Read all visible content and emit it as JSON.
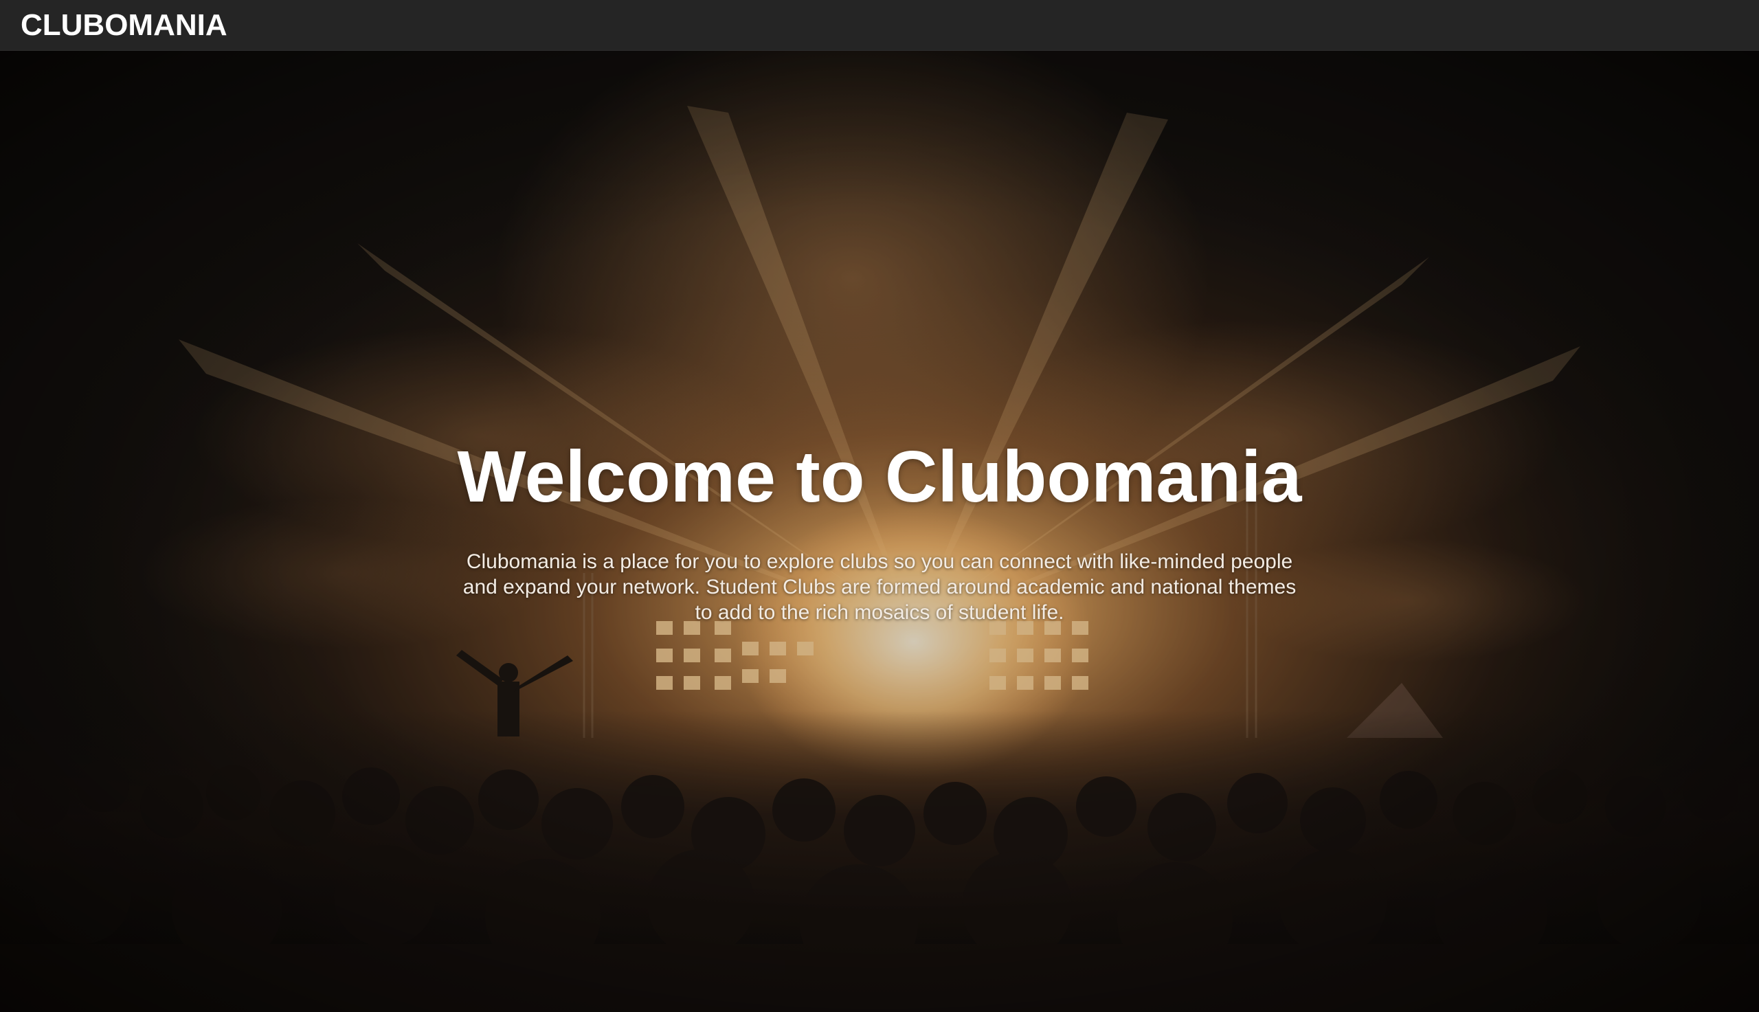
{
  "navbar": {
    "brand": "CLUBOMANIA"
  },
  "hero": {
    "title": "Welcome to Clubomania",
    "description": "Clubomania is a place for you to explore clubs so you can connect with like-minded people and expand your network. Student Clubs are formed around academic and national themes to add to the rich mosaics of student life."
  },
  "colors": {
    "navbar_bg": "#252525",
    "page_bg": "#111111",
    "text": "#ffffff",
    "stage_glow": "#f2b067"
  }
}
